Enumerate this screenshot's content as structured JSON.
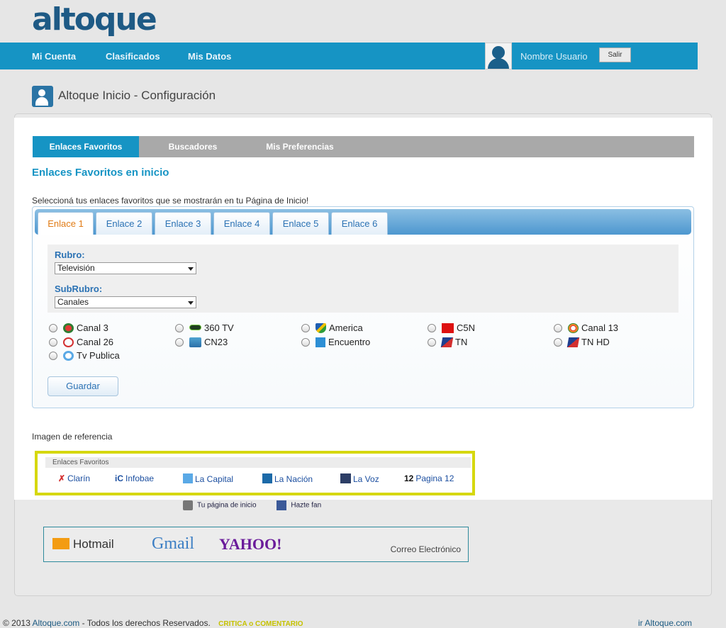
{
  "header": {
    "logo": "altoque",
    "nav": [
      "Mi Cuenta",
      "Clasificados",
      "Mis Datos"
    ],
    "user_name": "Nombre Usuario",
    "logout_label": "Salir"
  },
  "page": {
    "title": "Altoque Inicio - Configuración"
  },
  "modal": {
    "tabs": [
      "Enlaces Favoritos",
      "Buscadores",
      "Mis Preferencias"
    ],
    "heading": "Enlaces Favoritos en inicio",
    "description": "Seleccioná tus enlaces favoritos que se mostrarán en tu Página de Inicio!",
    "enlace_tabs": [
      "Enlace 1",
      "Enlace 2",
      "Enlace 3",
      "Enlace 4",
      "Enlace 5",
      "Enlace 6"
    ],
    "rubro": {
      "label": "Rubro:",
      "value": "Televisión"
    },
    "subrubro": {
      "label": "SubRubro:",
      "value": "Canales"
    },
    "channels": [
      {
        "name": "Canal 3",
        "icon": "canal3-logo"
      },
      {
        "name": "360 TV",
        "icon": "360tv-logo"
      },
      {
        "name": "America",
        "icon": "america-logo"
      },
      {
        "name": "C5N",
        "icon": "c5n-logo"
      },
      {
        "name": "Canal 13",
        "icon": "canal13-logo"
      },
      {
        "name": "Canal 26",
        "icon": "canal26-logo"
      },
      {
        "name": "CN23",
        "icon": "cn23-logo"
      },
      {
        "name": "Encuentro",
        "icon": "encuentro-logo"
      },
      {
        "name": "TN",
        "icon": "tn-logo"
      },
      {
        "name": "TN HD",
        "icon": "tnhd-logo"
      },
      {
        "name": "Tv Publica",
        "icon": "tvpublica-logo"
      }
    ],
    "save_label": "Guardar",
    "reference_label": "Imagen de referencia",
    "reference": {
      "header": "Enlaces Favoritos",
      "items": [
        "Clarín",
        "Infobae",
        "La Capital",
        "La Nación",
        "La Voz",
        "Pagina 12"
      ]
    }
  },
  "background": {
    "home_link": "Tu página de inicio",
    "fan_link": "Hazte fan",
    "mail": {
      "hotmail": "Hotmail",
      "gmail": "Gmail",
      "yahoo": "YAHOO!",
      "label": "Correo Electrónico"
    }
  },
  "footer": {
    "copyright": "© 2013",
    "site": "Altoque.com",
    "rights": "- Todos los derechos Reservados.",
    "critique": "CRITICA o COMENTARIO",
    "right_link": "ir Altoque.com"
  },
  "colors": {
    "brand": "#1694c4",
    "accent": "#e17b15",
    "highlight": "#d6d80e"
  }
}
